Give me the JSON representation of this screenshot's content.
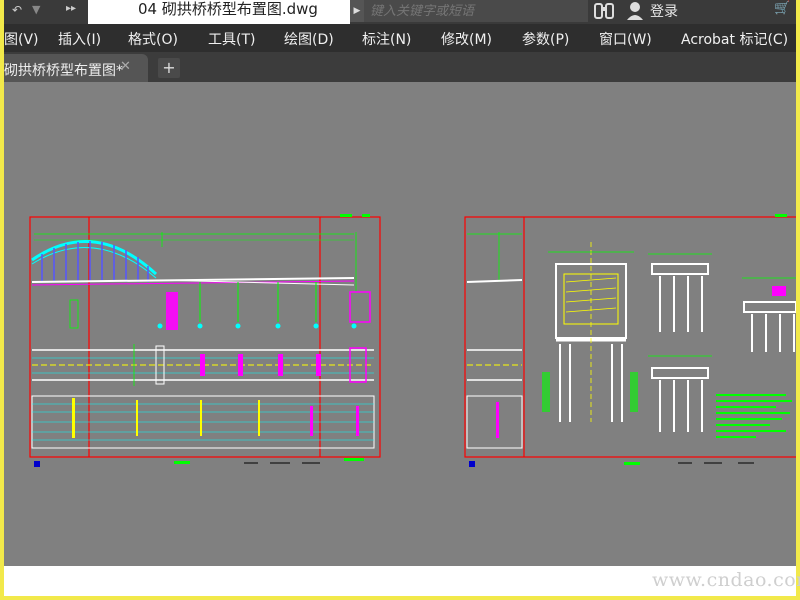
{
  "titlebar": {
    "document_title": "04 砌拱桥桥型布置图.dwg",
    "search_placeholder": "键入关键字或短语",
    "login_label": "登录"
  },
  "menubar": {
    "items": [
      {
        "label": "图(V)"
      },
      {
        "label": "插入(I)"
      },
      {
        "label": "格式(O)"
      },
      {
        "label": "工具(T)"
      },
      {
        "label": "绘图(D)"
      },
      {
        "label": "标注(N)"
      },
      {
        "label": "修改(M)"
      },
      {
        "label": "参数(P)"
      },
      {
        "label": "窗口(W)"
      },
      {
        "label": "Acrobat 标记(C)"
      }
    ]
  },
  "tabs": [
    {
      "label": "砌拱桥桥型布置图*",
      "active": true
    }
  ],
  "watermark": "www.cndao.com",
  "colors": {
    "canvas_bg": "#808080",
    "frame_red": "#ff0000",
    "line_green": "#00ff00",
    "line_cyan": "#00ffff",
    "line_magenta": "#ff00ff",
    "line_yellow": "#ffff00",
    "border_yellow": "#f2e94a"
  },
  "icons": [
    "quick-access-icon",
    "binoculars-icon",
    "user-icon",
    "cart-icon",
    "close-icon",
    "plus-icon"
  ]
}
